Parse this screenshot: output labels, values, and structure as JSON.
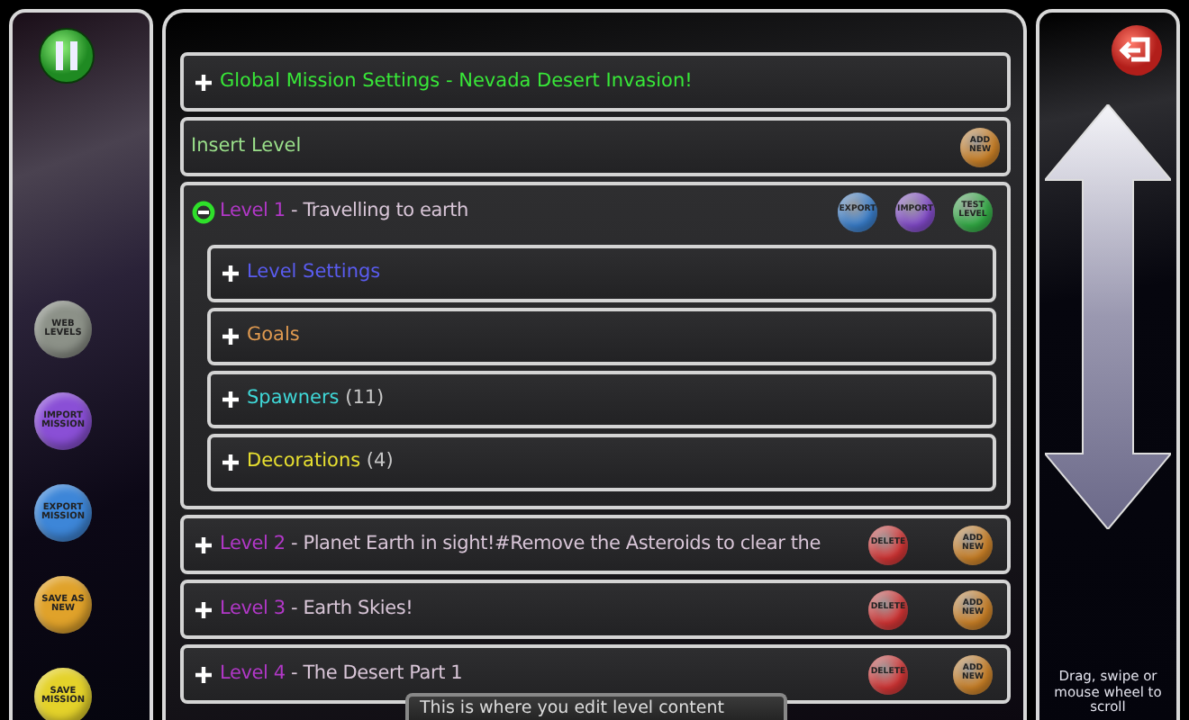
{
  "side_buttons": [
    {
      "label": "WEB LEVELS",
      "color": "#8c9188"
    },
    {
      "label": "IMPORT MISSION",
      "color": "#8a4fd6"
    },
    {
      "label": "EXPORT MISSION",
      "color": "#3d86d8"
    },
    {
      "label": "SAVE AS NEW",
      "color": "#e0a22a"
    },
    {
      "label": "SAVE MISSION",
      "color": "#e4d22a"
    }
  ],
  "mission_settings": {
    "label": "Global Mission Settings - Nevada Desert Invasion!",
    "expanded": false
  },
  "insert_level": {
    "label": "Insert Level",
    "button": {
      "label": "ADD NEW",
      "kind": "add"
    }
  },
  "levels": [
    {
      "prefix": "Level 1",
      "title": "- Travelling to earth",
      "expanded": true,
      "buttons": [
        {
          "label": "EXPORT",
          "kind": "export"
        },
        {
          "label": "IMPORT",
          "kind": "import"
        },
        {
          "label": "TEST LEVEL",
          "kind": "test"
        }
      ],
      "sections": [
        {
          "label": "Level Settings",
          "color": "#5a5cf0",
          "expanded": false
        },
        {
          "label": "Goals",
          "color": "#e09a50",
          "expanded": false
        },
        {
          "label": "Spawners",
          "count": "(11)",
          "color": "#3fd8d8",
          "expanded": false
        },
        {
          "label": "Decorations",
          "count": "(4)",
          "color": "#e8e030",
          "expanded": false
        }
      ]
    },
    {
      "prefix": "Level 2",
      "title": "- Planet Earth in sight!#Remove the Asteroids to clear the",
      "expanded": false,
      "buttons": [
        {
          "label": "DELETE",
          "kind": "delete"
        },
        {
          "label": "ADD NEW",
          "kind": "add"
        }
      ]
    },
    {
      "prefix": "Level 3",
      "title": "- Earth Skies!",
      "expanded": false,
      "buttons": [
        {
          "label": "DELETE",
          "kind": "delete"
        },
        {
          "label": "ADD NEW",
          "kind": "add"
        }
      ]
    },
    {
      "prefix": "Level 4",
      "title": "- The Desert Part 1",
      "expanded": false,
      "buttons": [
        {
          "label": "DELETE",
          "kind": "delete"
        },
        {
          "label": "ADD NEW",
          "kind": "add"
        }
      ]
    }
  ],
  "tooltip": "This is where you edit level content",
  "scroll_hint": "Drag, swipe or mouse wheel to scroll"
}
